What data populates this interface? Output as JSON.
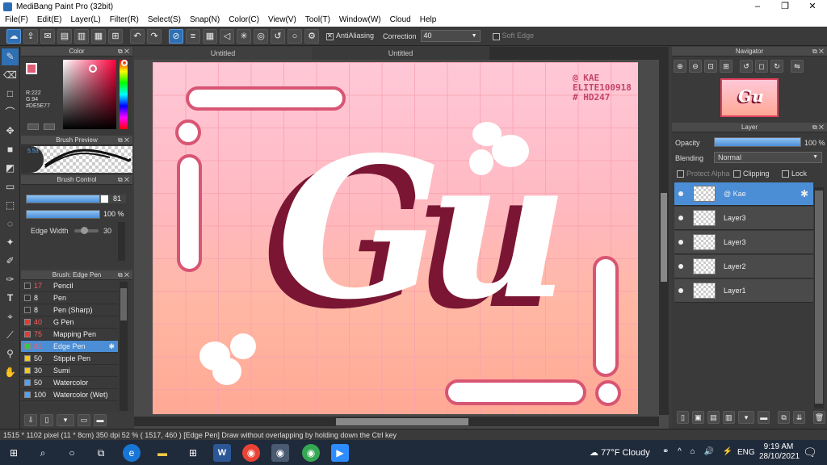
{
  "window": {
    "title": "MediBang Paint Pro (32bit)",
    "controls": [
      "–",
      "❐",
      "✕"
    ]
  },
  "menu": [
    "File(F)",
    "Edit(E)",
    "Layer(L)",
    "Filter(R)",
    "Select(S)",
    "Snap(N)",
    "Color(C)",
    "View(V)",
    "Tool(T)",
    "Window(W)",
    "Cloud",
    "Help"
  ],
  "toolbar": {
    "antialiasing_label": "AntiAliasing",
    "correction_label": "Correction",
    "correction_value": "40",
    "soft_edge_label": "Soft Edge"
  },
  "color_panel": {
    "title": "Color",
    "r": "R:222",
    "g": "G:94",
    "hex": "#DE5E77",
    "primary": "#de5e77",
    "hue_color": "#ff003c"
  },
  "brush_preview": {
    "title": "Brush Preview",
    "size": "5.53"
  },
  "brush_control": {
    "title": "Brush Control",
    "size_value": "81",
    "opacity_value": "100 %",
    "edge_width_label": "Edge Width",
    "edge_width_value": "30"
  },
  "brush_list": {
    "title": "Brush: Edge Pen",
    "items": [
      {
        "size": "17",
        "name": "Pencil",
        "color": "#333333",
        "size_red": true
      },
      {
        "size": "8",
        "name": "Pen",
        "color": "#333333",
        "size_red": false
      },
      {
        "size": "8",
        "name": "Pen (Sharp)",
        "color": "#333333",
        "size_red": false
      },
      {
        "size": "40",
        "name": "G Pen",
        "color": "#e53935",
        "size_red": true
      },
      {
        "size": "75",
        "name": "Mapping Pen",
        "color": "#e53935",
        "size_red": true
      },
      {
        "size": "81",
        "name": "Edge Pen",
        "color": "#2ecc40",
        "size_red": true
      },
      {
        "size": "50",
        "name": "Stipple Pen",
        "color": "#f5c518",
        "size_red": false
      },
      {
        "size": "30",
        "name": "Sumi",
        "color": "#f5c518",
        "size_red": false
      },
      {
        "size": "50",
        "name": "Watercolor",
        "color": "#4aa3ff",
        "size_red": false
      },
      {
        "size": "100",
        "name": "Watercolor (Wet)",
        "color": "#4aa3ff",
        "size_red": false
      }
    ],
    "selected": 5
  },
  "tabs": [
    "Untitled",
    "Untitled"
  ],
  "art": {
    "watermark_line1": "@ KAE",
    "watermark_line2": "ELITE100918",
    "watermark_line3": "# HD247",
    "lettering": "Gu"
  },
  "navigator": {
    "title": "Navigator"
  },
  "layer_panel": {
    "title": "Layer",
    "opacity_label": "Opacity",
    "opacity_value": "100 %",
    "opacity_fraction": 1.0,
    "blending_label": "Blending",
    "blending_value": "Normal",
    "protect_alpha": "Protect Alpha",
    "clipping": "Clipping",
    "lock": "Lock",
    "layers": [
      "@ Kae",
      "Layer3",
      "Layer3",
      "Layer2",
      "Layer1"
    ],
    "selected": 0
  },
  "status": "1515 * 1102 pixel   (11 * 8cm)   350 dpi   52 %   ( 1517, 460 )   [Edge Pen] Draw without overlapping by holding down the Ctrl key",
  "taskbar": {
    "weather": "77°F  Cloudy",
    "lang": "ENG",
    "time": "9:19 AM",
    "date": "28/10/2021"
  }
}
